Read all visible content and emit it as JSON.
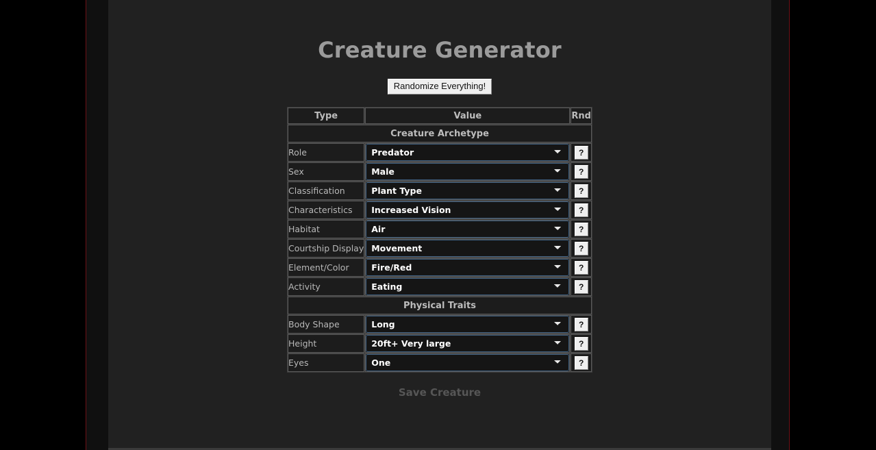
{
  "page": {
    "title": "Creature Generator",
    "randomize_button": "Randomize Everything!",
    "save_label": "Save Creature"
  },
  "table": {
    "headers": {
      "type": "Type",
      "value": "Value",
      "rnd": "Rnd"
    },
    "rnd_button_label": "?",
    "sections": [
      {
        "title": "Creature Archetype",
        "rows": [
          {
            "label": "Role",
            "value": "Predator"
          },
          {
            "label": "Sex",
            "value": "Male"
          },
          {
            "label": "Classification",
            "value": "Plant Type"
          },
          {
            "label": "Characteristics",
            "value": "Increased Vision"
          },
          {
            "label": "Habitat",
            "value": "Air"
          },
          {
            "label": "Courtship Display",
            "value": "Movement"
          },
          {
            "label": "Element/Color",
            "value": "Fire/Red"
          },
          {
            "label": "Activity",
            "value": "Eating"
          }
        ]
      },
      {
        "title": "Physical Traits",
        "rows": [
          {
            "label": "Body Shape",
            "value": "Long"
          },
          {
            "label": "Height",
            "value": "20ft+ Very large"
          },
          {
            "label": "Eyes",
            "value": "One"
          }
        ]
      }
    ]
  },
  "colors": {
    "page_background": "#000000",
    "panel_background": "#212121",
    "accent_rule": "#6e1117",
    "select_border": "#3c5d7e",
    "title_text": "#9b9b9b",
    "save_text": "#565656"
  }
}
